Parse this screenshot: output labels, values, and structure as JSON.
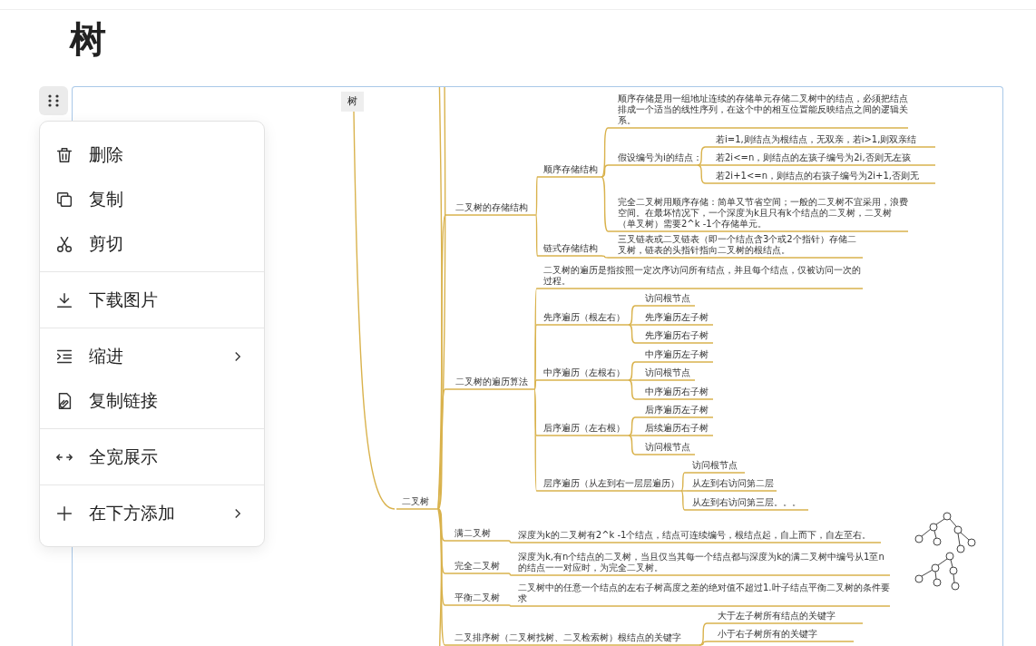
{
  "page_title": "树",
  "block_menu": {
    "groups": [
      {
        "items": [
          {
            "label": "删除",
            "submenu": false
          },
          {
            "label": "复制",
            "submenu": false
          },
          {
            "label": "剪切",
            "submenu": false
          }
        ]
      },
      {
        "items": [
          {
            "label": "下载图片",
            "submenu": false
          }
        ]
      },
      {
        "items": [
          {
            "label": "缩进",
            "submenu": true
          },
          {
            "label": "复制链接",
            "submenu": false
          }
        ]
      },
      {
        "items": [
          {
            "label": "全宽展示",
            "submenu": false
          }
        ]
      },
      {
        "items": [
          {
            "label": "在下方添加",
            "submenu": true
          }
        ]
      }
    ]
  },
  "mindmap": {
    "label": "树",
    "children": [
      {
        "label": "二叉树",
        "children": [
          {
            "label": "二叉树的存储结构",
            "children": [
              {
                "label": "顺序存储结构",
                "children": [
                  {
                    "label": "顺序存储是用一组地址连续的存储单元存储二叉树中的结点，必须把结点排成一个适当的线性序列，在这个中的相互位置能反映结点之间的逻辑关系。"
                  },
                  {
                    "label": "假设编号为i的结点：",
                    "children": [
                      {
                        "label": "若i=1,则结点为根结点，无双亲，若i>1,则双亲结"
                      },
                      {
                        "label": "若2i<=n，则结点的左孩子编号为2i,否则无左孩"
                      },
                      {
                        "label": "若2i+1<=n，则结点的右孩子编号为2i+1,否则无"
                      }
                    ]
                  },
                  {
                    "label": "完全二叉树用顺序存储：简单又节省空间；一般的二叉树不宜采用，浪费空间。在最坏情况下，一个深度为k且只有k个结点的二叉树，二叉树（单叉树）需要2^k -1个存储单元。"
                  }
                ]
              },
              {
                "label": "链式存储结构",
                "children": [
                  {
                    "label": "三叉链表或二叉链表（即一个结点含3个或2个指针）存储二叉树，链表的头指针指向二叉树的根结点。"
                  }
                ]
              }
            ]
          },
          {
            "label": "二叉树的遍历算法",
            "children": [
              {
                "label": "二叉树的遍历是指按照一定次序访问所有结点，并且每个结点，仅被访问一次的过程。"
              },
              {
                "label": "先序遍历（根左右）",
                "children": [
                  {
                    "label": "访问根节点"
                  },
                  {
                    "label": "先序遍历左子树"
                  },
                  {
                    "label": "先序遍历右子树"
                  }
                ]
              },
              {
                "label": "中序遍历（左根右）",
                "children": [
                  {
                    "label": "中序遍历左子树"
                  },
                  {
                    "label": "访问根节点"
                  },
                  {
                    "label": "中序遍历右子树"
                  }
                ]
              },
              {
                "label": "后序遍历（左右根）",
                "children": [
                  {
                    "label": "后序遍历左子树"
                  },
                  {
                    "label": "后续遍历右子树"
                  },
                  {
                    "label": "访问根节点"
                  }
                ]
              },
              {
                "label": "层序遍历（从左到右一层层遍历）",
                "children": [
                  {
                    "label": "访问根节点"
                  },
                  {
                    "label": "从左到右访问第二层"
                  },
                  {
                    "label": "从左到右访问第三层。。。"
                  }
                ]
              }
            ]
          },
          {
            "label": "满二叉树",
            "children": [
              {
                "label": "深度为k的二叉树有2^k -1个结点，结点可连续编号，根结点起，自上而下，自左至右。"
              }
            ]
          },
          {
            "label": "完全二叉树",
            "children": [
              {
                "label": "深度为k,有n个结点的二叉树，当且仅当其每一个结点都与深度为k的满二叉树中编号从1至n的结点一一对应时，为完全二叉树。"
              }
            ]
          },
          {
            "label": "平衡二叉树",
            "children": [
              {
                "label": "二叉树中的任意一个结点的左右子树高度之差的绝对值不超过1.叶子结点平衡二叉树的条件要求"
              }
            ]
          },
          {
            "label": "二叉排序树（二叉树找树、二叉检索树）根结点的关键字",
            "children": [
              {
                "label": "大于左子树所有结点的关键字"
              },
              {
                "label": "小于右子树所有的关键字"
              }
            ]
          }
        ]
      }
    ]
  }
}
